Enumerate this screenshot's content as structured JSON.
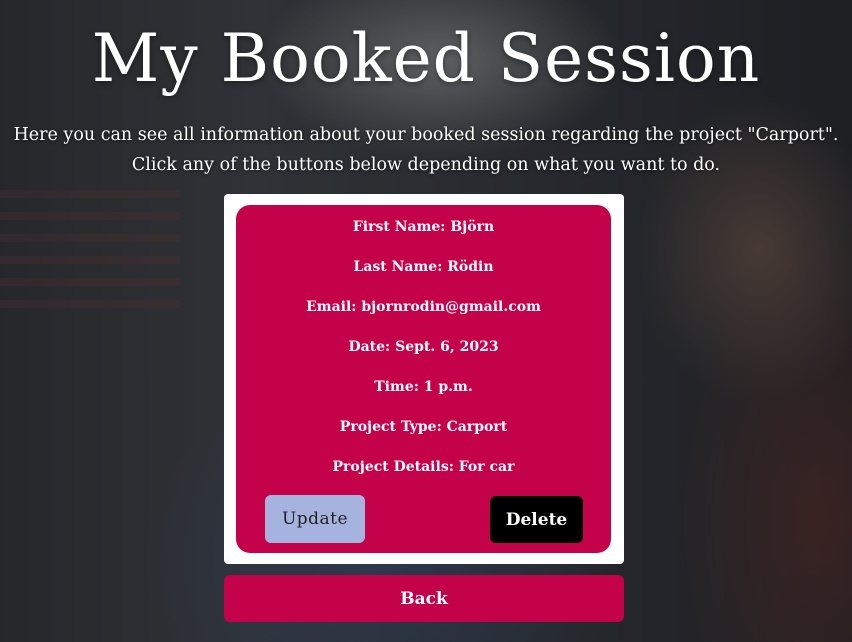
{
  "page": {
    "title": "My Booked Session",
    "subtitle_line1": "Here you can see all information about your booked session regarding the project \"Carport\".",
    "subtitle_line2": "Click any of the buttons below depending on what you want to do."
  },
  "booking": {
    "first_name": {
      "label": "First Name:",
      "value": "Björn"
    },
    "last_name": {
      "label": "Last Name:",
      "value": "Rödin"
    },
    "email": {
      "label": "Email:",
      "value": "bjornrodin@gmail.com"
    },
    "date": {
      "label": "Date:",
      "value": "Sept. 6, 2023"
    },
    "time": {
      "label": "Time:",
      "value": "1 p.m."
    },
    "project_type": {
      "label": "Project Type:",
      "value": "Carport"
    },
    "project_details": {
      "label": "Project Details:",
      "value": "For car"
    }
  },
  "actions": {
    "update_label": "Update",
    "delete_label": "Delete",
    "back_label": "Back"
  },
  "colors": {
    "accent": "#c4024a",
    "update_button": "#a6b3df",
    "delete_button": "#000000",
    "card_frame": "#ffffff"
  }
}
